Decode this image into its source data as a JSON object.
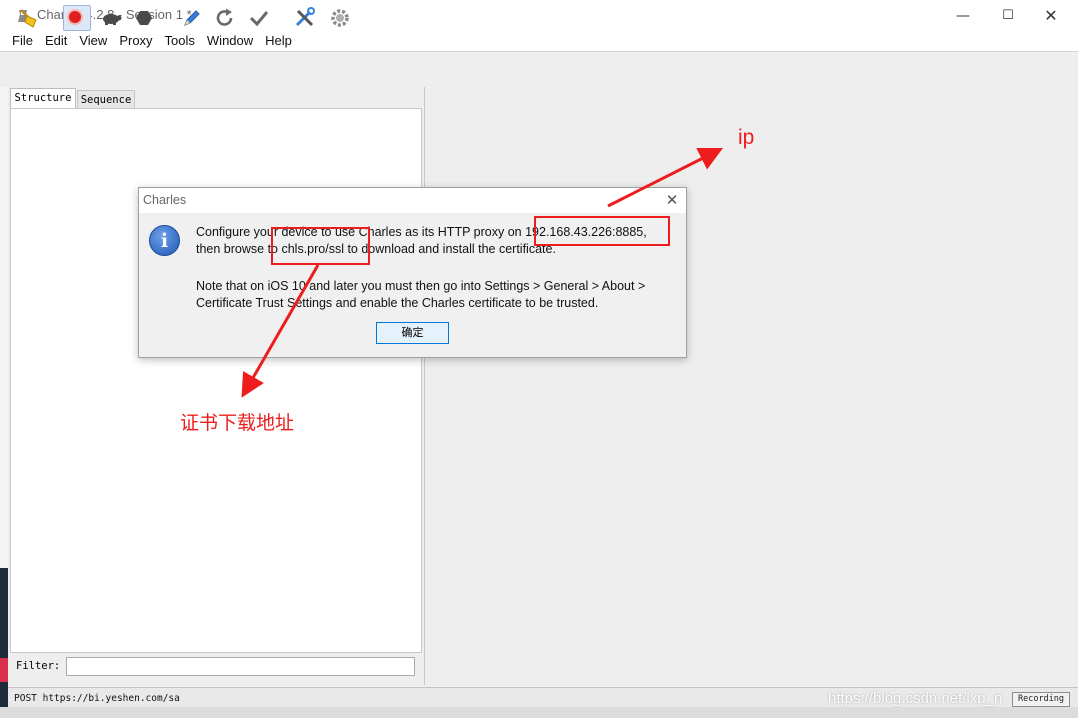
{
  "window": {
    "title": "Charles 4.2.8 - Session 1 *",
    "controls": {
      "minimize": "—",
      "maximize": "☐",
      "close": "✕"
    }
  },
  "menubar": {
    "items": [
      "File",
      "Edit",
      "View",
      "Proxy",
      "Tools",
      "Window",
      "Help"
    ]
  },
  "toolbar": {
    "icons": [
      "broom-icon",
      "record-icon",
      "turtle-icon",
      "stop-hexagon-icon",
      "pen-icon",
      "refresh-icon",
      "check-icon",
      "tools-icon",
      "gear-icon"
    ]
  },
  "left_panel": {
    "tabs": [
      "Structure",
      "Sequence"
    ],
    "filter_label": "Filter:",
    "filter_value": ""
  },
  "status_bar": {
    "text": "POST https://bi.yeshen.com/sa",
    "recording": "Recording"
  },
  "dialog": {
    "title": "Charles",
    "close": "✕",
    "icon": "i",
    "line1": "Configure your device to use Charles as its HTTP proxy on 192.168.43.226:8885,",
    "line2": "then browse to chls.pro/ssl to download and install the certificate.",
    "line3": "Note that on iOS 10 and later you must then go into Settings > General > About >",
    "line4": "Certificate Trust Settings and enable the Charles certificate to be trusted.",
    "ok_label": "确定"
  },
  "annotations": {
    "ip_label": "ip",
    "cert_label": "证书下载地址",
    "color": "#ee1d1d"
  },
  "watermark": "https://blog.csdn.net/lxp_n"
}
